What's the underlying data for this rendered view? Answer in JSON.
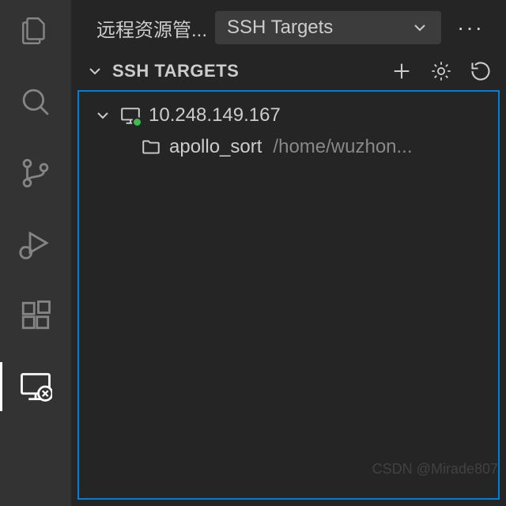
{
  "header": {
    "title": "远程资源管...",
    "dropdown_label": "SSH Targets"
  },
  "section": {
    "title": "SSH TARGETS"
  },
  "tree": {
    "host_ip": "10.248.149.167",
    "folder_name": "apollo_sort",
    "folder_path": "/home/wuzhon..."
  },
  "watermark": "CSDN @Mirade807"
}
